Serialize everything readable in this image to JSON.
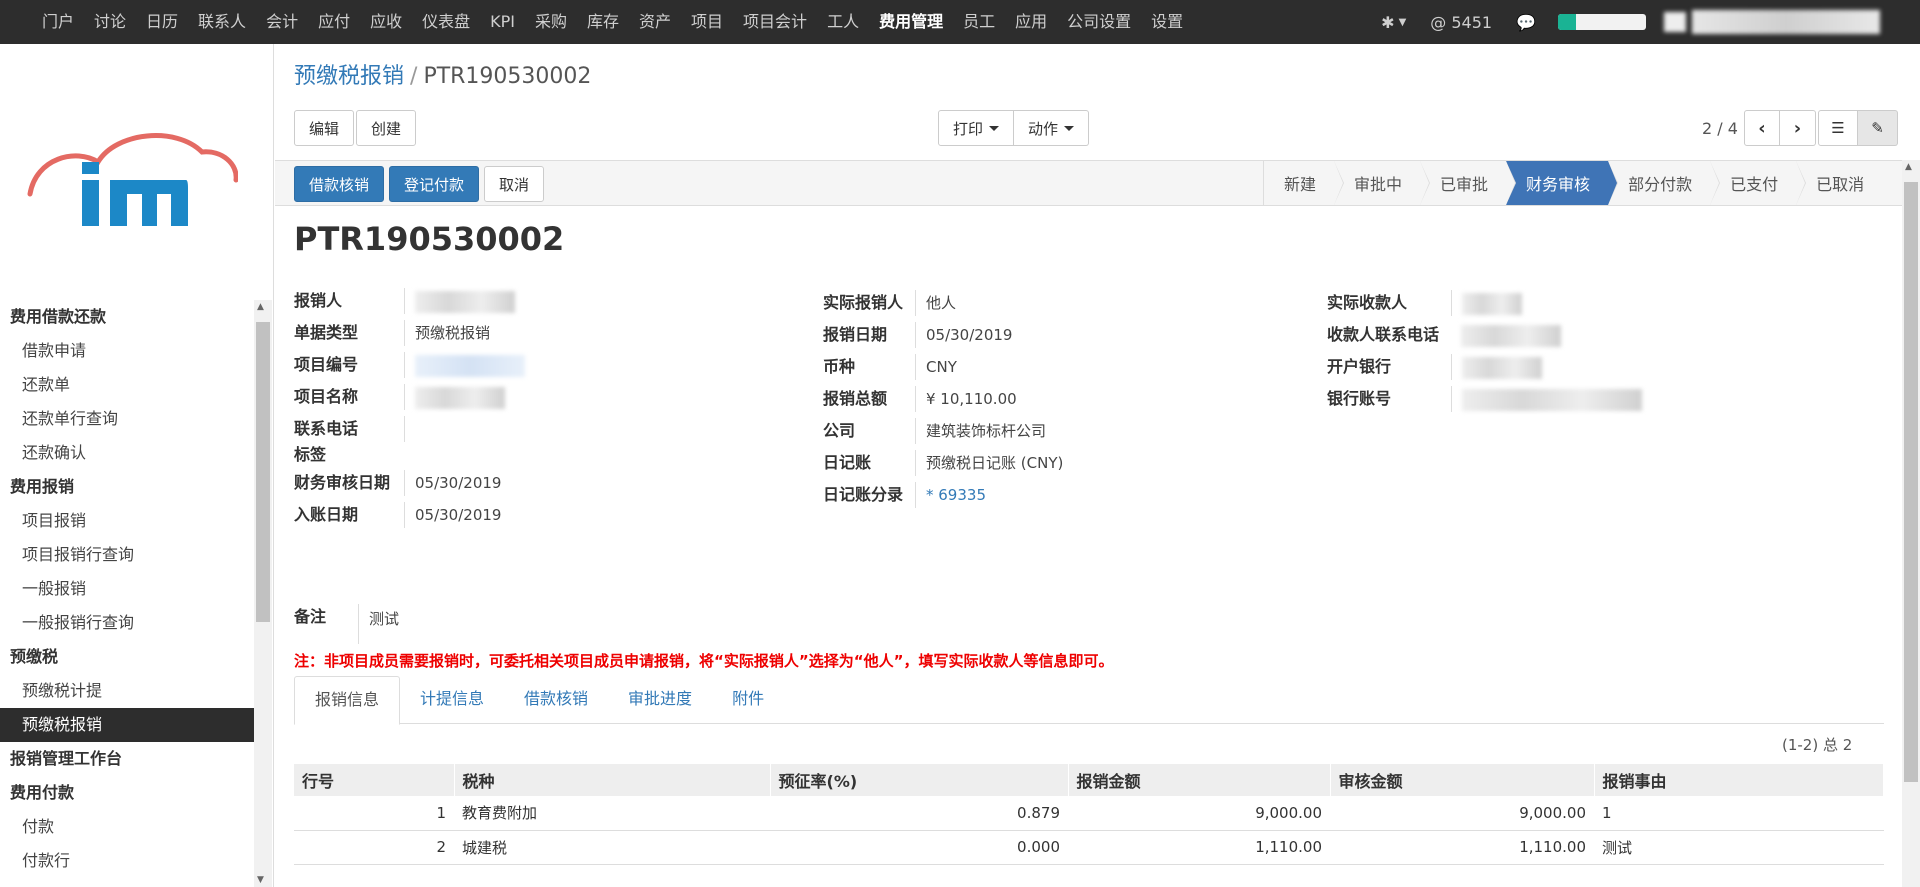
{
  "topnav": {
    "items": [
      "门户",
      "讨论",
      "日历",
      "联系人",
      "会计",
      "应付",
      "应收",
      "仪表盘",
      "KPI",
      "采购",
      "库存",
      "资产",
      "项目",
      "项目会计",
      "工人",
      "费用管理",
      "员工",
      "应用",
      "公司设置",
      "设置"
    ],
    "active": "费用管理",
    "mail_count": "@ 5451",
    "progress_pct": 20,
    "accent": "#1ab394"
  },
  "sidebar": {
    "groups": [
      {
        "label": "费用借款还款",
        "items": [
          "借款申请",
          "还款单",
          "还款单行查询",
          "还款确认"
        ]
      },
      {
        "label": "费用报销",
        "items": [
          "项目报销",
          "项目报销行查询",
          "一般报销",
          "一般报销行查询"
        ]
      },
      {
        "label": "预缴税",
        "items": [
          "预缴税计提",
          "预缴税报销"
        ]
      },
      {
        "label": "报销管理工作台",
        "items": []
      },
      {
        "label": "费用付款",
        "items": [
          "付款",
          "付款行"
        ]
      }
    ],
    "selected": "预缴税报销"
  },
  "breadcrumb": {
    "parent": "预缴税报销",
    "current": "PTR190530002"
  },
  "toolbar": {
    "edit": "编辑",
    "create": "创建",
    "print": "打印",
    "action": "动作",
    "pager": "2 / 4"
  },
  "status": {
    "actions": [
      "借款核销",
      "登记付款",
      "取消"
    ],
    "stages": [
      "新建",
      "审批中",
      "已审批",
      "财务审核",
      "部分付款",
      "已支付",
      "已取消"
    ],
    "active_stage": "财务审核",
    "active_color": "#3f74b6"
  },
  "doc": {
    "title": "PTR190530002",
    "col1": {
      "reporter_label": "报销人",
      "doc_type_label": "单据类型",
      "doc_type": "预缴税报销",
      "project_no_label": "项目编号",
      "project_name_label": "项目名称",
      "phone_label": "联系电话",
      "tags_label": "标签",
      "audit_date_label": "财务审核日期",
      "audit_date": "05/30/2019",
      "entry_date_label": "入账日期",
      "entry_date": "05/30/2019"
    },
    "col2": {
      "actual_reporter_label": "实际报销人",
      "actual_reporter": "他人",
      "report_date_label": "报销日期",
      "report_date": "05/30/2019",
      "currency_label": "币种",
      "currency": "CNY",
      "total_label": "报销总额",
      "total": "¥ 10,110.00",
      "company_label": "公司",
      "company": "建筑装饰标杆公司",
      "journal_label": "日记账",
      "journal": "预缴税日记账 (CNY)",
      "journal_entry_label": "日记账分录",
      "journal_entry": "* 69335"
    },
    "col3": {
      "payee_label": "实际收款人",
      "payee_phone_label": "收款人联系电话",
      "bank_label": "开户银行",
      "account_label": "银行账号"
    },
    "note_label": "备注",
    "note": "测试",
    "warning": "注：非项目成员需要报销时，可委托相关项目成员申请报销，将“实际报销人”选择为“他人”，填写实际收款人等信息即可。"
  },
  "tabs": [
    "报销信息",
    "计提信息",
    "借款核销",
    "审批进度",
    "附件"
  ],
  "active_tab": "报销信息",
  "lines": {
    "pager": "(1-2) 总 2",
    "headers": [
      "行号",
      "税种",
      "预征率(%)",
      "报销金额",
      "审核金额",
      "报销事由"
    ],
    "rows": [
      [
        "1",
        "教育费附加",
        "0.879",
        "9,000.00",
        "9,000.00",
        "1"
      ],
      [
        "2",
        "城建税",
        "0.000",
        "1,110.00",
        "1,110.00",
        "测试"
      ]
    ]
  }
}
